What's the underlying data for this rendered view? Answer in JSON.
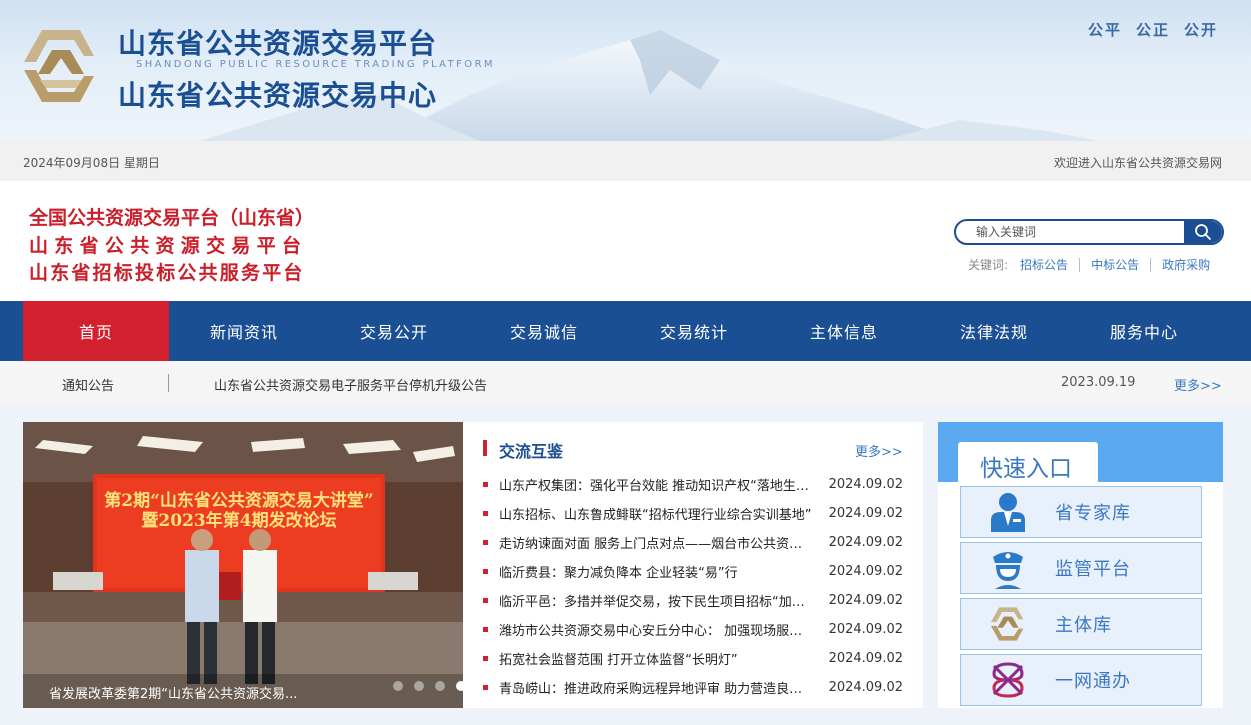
{
  "header": {
    "title_cn_1": "山东省公共资源交易平台",
    "title_en": "SHANDONG PUBLIC RESOURCE TRADING PLATFORM",
    "title_cn_2": "山东省公共资源交易中心",
    "motto": [
      "公平",
      "公正",
      "公开"
    ]
  },
  "datebar": {
    "date": "2024年09月08日  星期日",
    "welcome": "欢迎进入山东省公共资源交易网"
  },
  "platforms": [
    "全国公共资源交易平台（山东省）",
    "山东省公共资源交易平台",
    "山东省招标投标公共服务平台"
  ],
  "search": {
    "placeholder": "输入关键词",
    "keywords_label": "关键词:",
    "keywords": [
      "招标公告",
      "中标公告",
      "政府采购"
    ]
  },
  "nav": [
    "首页",
    "新闻资讯",
    "交易公开",
    "交易诚信",
    "交易统计",
    "主体信息",
    "法律法规",
    "服务中心"
  ],
  "notice": {
    "label": "通知公告",
    "text": "山东省公共资源交易电子服务平台停机升级公告",
    "date": "2023.09.19",
    "more": "更多>>"
  },
  "slider": {
    "banner_line1": "第2期“山东省公共资源交易大讲堂”",
    "banner_line2": "暨2023年第4期发改论坛",
    "caption": "省发展改革委第2期“山东省公共资源交易...",
    "active_index": 3
  },
  "news": {
    "title": "交流互鉴",
    "more": "更多>>",
    "items": [
      {
        "t": "山东产权集团：强化平台效能 推动知识产权“落地生根”",
        "d": "2024.09.02"
      },
      {
        "t": "山东招标、山东鲁成鲱联“招标代理行业综合实训基地”",
        "d": "2024.09.02"
      },
      {
        "t": "走访纳谏面对面 服务上门点对点——烟台市公共资源交易中心",
        "d": "2024.09.02"
      },
      {
        "t": "临沂费县：聚力减负降本 企业轻装“易”行",
        "d": "2024.09.02"
      },
      {
        "t": "临沂平邑：多措并举促交易，按下民生项目招标“加速键”",
        "d": "2024.09.02"
      },
      {
        "t": "潍坊市公共资源交易中心安丘分中心： 加强现场服务管理",
        "d": "2024.09.02"
      },
      {
        "t": "拓宽社会监督范围 打开立体监督“长明灯”",
        "d": "2024.09.02"
      },
      {
        "t": "青岛崂山：推进政府采购远程异地评审 助力营造良好环境",
        "d": "2024.09.02"
      }
    ]
  },
  "quick": {
    "title": "快速入口",
    "items": [
      {
        "label": "省专家库",
        "icon": "expert-icon"
      },
      {
        "label": "监管平台",
        "icon": "supervisor-icon"
      },
      {
        "label": "主体库",
        "icon": "entity-logo-icon"
      },
      {
        "label": "一网通办",
        "icon": "one-network-icon"
      }
    ]
  },
  "colors": {
    "brand_blue": "#1b4f93",
    "accent_red": "#d2202e",
    "light_blue": "#5ba9f0"
  }
}
